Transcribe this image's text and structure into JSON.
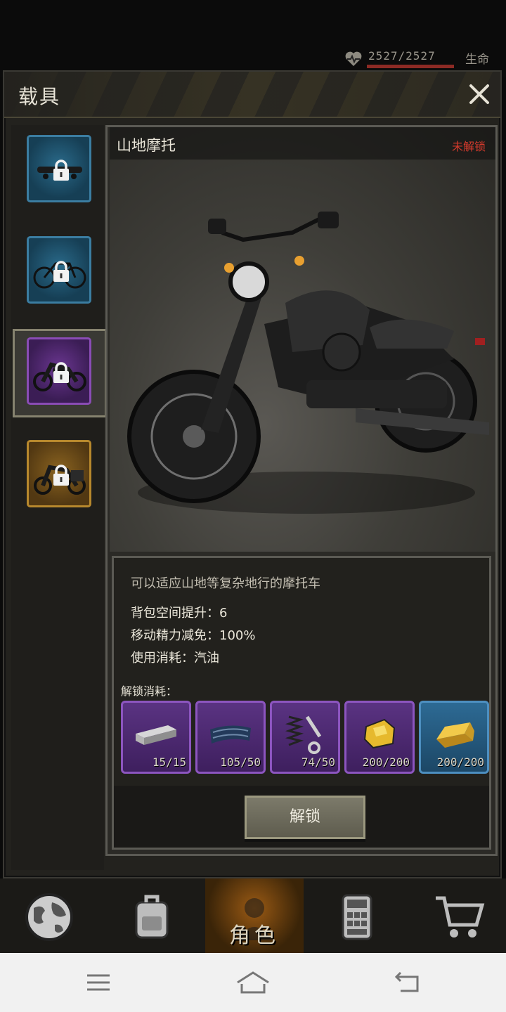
{
  "hud": {
    "hp_value": "2527/2527",
    "hp_label": "生命"
  },
  "modal": {
    "title": "载具",
    "close_icon": "close-icon"
  },
  "vehicles": [
    {
      "icon": "skateboard-icon",
      "rarity_color": "#2a6a8a",
      "locked": true
    },
    {
      "icon": "bicycle-icon",
      "rarity_color": "#2a6a8a",
      "locked": true
    },
    {
      "icon": "motorcycle-icon",
      "rarity_color": "#6a3690",
      "locked": true,
      "selected": true
    },
    {
      "icon": "touring-motorcycle-icon",
      "rarity_color": "#8a6320",
      "locked": true
    }
  ],
  "detail": {
    "name": "山地摩托",
    "status": "未解锁",
    "description": "可以适应山地等复杂地行的摩托车",
    "stats": [
      "背包空间提升：6",
      "移动精力减免：100%",
      "使用消耗：汽油"
    ],
    "unlock_cost_label": "解锁消耗：",
    "costs": [
      {
        "icon": "steel-beam-icon",
        "count": "15/15",
        "color": "#5a3382"
      },
      {
        "icon": "steel-sheet-icon",
        "count": "105/50",
        "color": "#5a3382"
      },
      {
        "icon": "spring-bolt-icon",
        "count": "74/50",
        "color": "#5a3382"
      },
      {
        "icon": "gold-ore-icon",
        "count": "200/200",
        "color": "#5a3382"
      },
      {
        "icon": "gold-bar-icon",
        "count": "200/200",
        "color": "#2d6a94"
      }
    ],
    "unlock_button": "解锁"
  },
  "nav": {
    "role_label": "角色",
    "items": [
      "globe-icon",
      "backpack-icon",
      "role-icon",
      "calculator-icon",
      "cart-icon"
    ]
  },
  "system_bar": {
    "items": [
      "menu-icon",
      "home-icon",
      "back-icon"
    ]
  }
}
